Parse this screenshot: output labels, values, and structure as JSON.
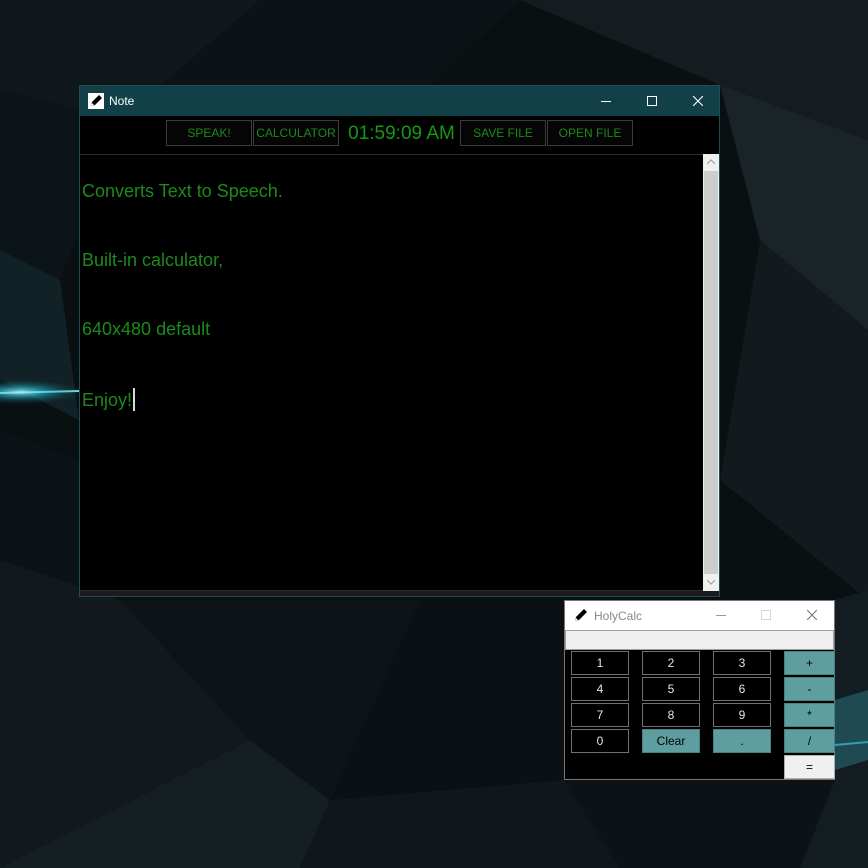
{
  "note": {
    "title": "Note",
    "toolbar": {
      "speak": "SPEAK!",
      "calculator": "CALCULATOR",
      "clock": "01:59:09 AM",
      "save": "SAVE FILE",
      "open": "OPEN FILE"
    },
    "editor": {
      "lines": [
        "Converts Text to Speech.",
        "Built-in calculator,",
        "640x480 default",
        "Enjoy!"
      ]
    }
  },
  "calc": {
    "title": "HolyCalc",
    "keys": {
      "k1": "1",
      "k2": "2",
      "k3": "3",
      "plus": "+",
      "k4": "4",
      "k5": "5",
      "k6": "6",
      "minus": "-",
      "k7": "7",
      "k8": "8",
      "k9": "9",
      "multiply": "*",
      "k0": "0",
      "clear": "Clear",
      "dot": ".",
      "divide": "/",
      "equals": "="
    }
  },
  "colors": {
    "note_titlebar": "#124048",
    "text_green": "#1c8a1c",
    "calc_accent": "#5f9ea0",
    "desktop_bg": "#0b1013"
  },
  "icons": [
    "pencil-icon",
    "minimize-icon",
    "maximize-icon",
    "close-icon",
    "scroll-up-arrow-icon",
    "scroll-down-arrow-icon"
  ]
}
